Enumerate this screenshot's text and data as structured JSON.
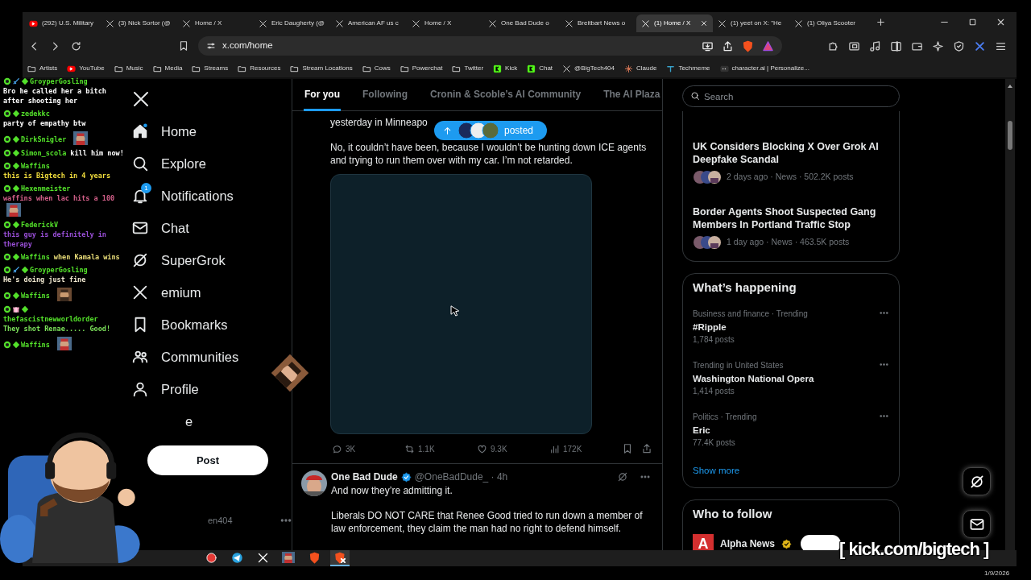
{
  "browser": {
    "tabs": [
      {
        "title": "(292) U.S. Military",
        "kind": "youtube",
        "selected": false
      },
      {
        "title": "(3) Nick Sortor (@",
        "kind": "x",
        "selected": false
      },
      {
        "title": "Home / X",
        "kind": "x",
        "selected": false
      },
      {
        "title": "Eric Daugherty (@",
        "kind": "x",
        "selected": false
      },
      {
        "title": "American AF us c",
        "kind": "x",
        "selected": false
      },
      {
        "title": "Home / X",
        "kind": "x",
        "selected": false
      },
      {
        "title": "One Bad Dude o",
        "kind": "x",
        "selected": false
      },
      {
        "title": "Breitbart News o",
        "kind": "x",
        "selected": false
      },
      {
        "title": "(1) Home / X",
        "kind": "x",
        "selected": true
      },
      {
        "title": "(1) yeet on X: \"He",
        "kind": "x",
        "selected": false
      },
      {
        "title": "(1) Oliya Scooter",
        "kind": "x",
        "selected": false
      }
    ],
    "address": "x.com/home",
    "bookmarks": [
      {
        "label": "Artists",
        "kind": "folder"
      },
      {
        "label": "YouTube",
        "kind": "youtube"
      },
      {
        "label": "Music",
        "kind": "folder"
      },
      {
        "label": "Media",
        "kind": "folder"
      },
      {
        "label": "Streams",
        "kind": "folder"
      },
      {
        "label": "Resources",
        "kind": "folder"
      },
      {
        "label": "Stream Locations",
        "kind": "folder"
      },
      {
        "label": "Cows",
        "kind": "folder"
      },
      {
        "label": "Powerchat",
        "kind": "folder"
      },
      {
        "label": "Twitter",
        "kind": "folder"
      },
      {
        "label": "Kick",
        "kind": "kick"
      },
      {
        "label": "Chat",
        "kind": "kick"
      },
      {
        "label": "@BigTech404",
        "kind": "x"
      },
      {
        "label": "Claude",
        "kind": "claude"
      },
      {
        "label": "Techmeme",
        "kind": "techmeme"
      },
      {
        "label": "character.ai | Personalize...",
        "kind": "charai"
      }
    ]
  },
  "x": {
    "nav": [
      {
        "label": "Home",
        "kind": "home"
      },
      {
        "label": "Explore",
        "kind": "search"
      },
      {
        "label": "Notifications",
        "kind": "bell",
        "badge": "1"
      },
      {
        "label": "Chat",
        "kind": "mail"
      },
      {
        "label": "SuperGrok",
        "kind": "grok"
      },
      {
        "label": "emium",
        "kind": "x"
      },
      {
        "label": "Bookmarks",
        "kind": "bookmark"
      },
      {
        "label": "Communities",
        "kind": "people"
      },
      {
        "label": "Profile",
        "kind": "person"
      },
      {
        "label": "e",
        "kind": "plain"
      }
    ],
    "post_button": "Post",
    "account_handle": "en404",
    "feed_tabs": [
      {
        "label": "For you",
        "selected": true
      },
      {
        "label": "Following",
        "selected": false
      },
      {
        "label": "Cronin & Scoble’s AI Community",
        "selected": false
      },
      {
        "label": "The AI Plaza",
        "selected": false
      }
    ],
    "new_posts_pill": "posted",
    "posts": [
      {
        "paragraphs": [
          "yesterday in Minneapo",
          "No, it couldn’t have been, because I wouldn’t be hunting down ICE agents and trying to run them over with my car. I’m not retarded."
        ],
        "media": true,
        "stats": [
          {
            "kind": "replies",
            "value": "3K"
          },
          {
            "kind": "reposts",
            "value": "1.1K"
          },
          {
            "kind": "likes",
            "value": "9.3K"
          },
          {
            "kind": "views",
            "value": "172K"
          }
        ]
      },
      {
        "author": "One Bad Dude",
        "verified": true,
        "handle": "@OneBadDude_ · 4h",
        "paragraphs": [
          "And now they’re admitting it.",
          "Liberals DO NOT CARE that Renee Good tried to run down a member of law enforcement, they claim the man had no right to defend himself."
        ]
      }
    ],
    "search": {
      "placeholder": "Search"
    },
    "news": [
      {
        "title": "UK Considers Blocking X Over Grok AI Deepfake Scandal",
        "meta": "2 days ago · News · 502.2K posts"
      },
      {
        "title": "Border Agents Shoot Suspected Gang Members In Portland Traffic Stop",
        "meta": "1 day ago · News · 463.5K posts"
      }
    ],
    "whats_happening": {
      "title": "What’s happening",
      "trends": [
        {
          "context": "Business and finance · Trending",
          "name": "#Ripple",
          "posts": "1,784 posts"
        },
        {
          "context": "Trending in United States",
          "name": "Washington National Opera",
          "posts": "1,414 posts"
        },
        {
          "context": "Politics · Trending",
          "name": "Eric",
          "posts": "77.4K posts"
        }
      ],
      "show_more": "Show more"
    },
    "who_to_follow": {
      "title": "Who to follow",
      "accounts": [
        {
          "logo": "A",
          "name": "Alpha News",
          "verified": true
        }
      ]
    }
  },
  "chat": [
    {
      "user": "GroyperGosling",
      "badges": [
        {
          "kind": "kick"
        },
        {
          "kind": "sword"
        },
        {
          "kind": "diamond"
        }
      ],
      "text": "Bro he called her a bitch after shooting her",
      "color": "#ffffff"
    },
    {
      "user": "zedekkc",
      "badges": [
        {
          "kind": "kick"
        },
        {
          "kind": "diamond"
        }
      ],
      "text": "party of empathy btw",
      "color": "#ffffff"
    },
    {
      "user": "DirkSnigler",
      "badges": [
        {
          "kind": "kick"
        },
        {
          "kind": "diamond"
        }
      ],
      "emote": true
    },
    {
      "user": "Simon_scola",
      "badges": [
        {
          "kind": "kick"
        },
        {
          "kind": "diamond"
        }
      ],
      "text": "kill him now!",
      "color": "#ffffff"
    },
    {
      "user": "Waffins",
      "badges": [
        {
          "kind": "kick"
        },
        {
          "kind": "diamond"
        }
      ],
      "text": "this is Bigtech in 4 years",
      "color": "#f0dc3c"
    },
    {
      "user": "Hexenmeister",
      "badges": [
        {
          "kind": "kick"
        },
        {
          "kind": "diamond"
        }
      ],
      "text": "waffins when lac hits a 100",
      "color": "#d4608a",
      "emote": true
    },
    {
      "user": "FederickV",
      "badges": [
        {
          "kind": "kick"
        },
        {
          "kind": "diamond"
        }
      ],
      "text": "this guy is definitely in therapy",
      "color": "#9a4fd8"
    },
    {
      "user": "Waffins",
      "badges": [
        {
          "kind": "kick"
        },
        {
          "kind": "diamond"
        }
      ],
      "text": "when Kamala wins",
      "color": "#e8dc78"
    },
    {
      "user": "GroyperGosling",
      "badges": [
        {
          "kind": "kick"
        },
        {
          "kind": "sword"
        },
        {
          "kind": "diamond"
        }
      ],
      "text": "He's doing just fine",
      "color": "#f0e8d0"
    },
    {
      "user": "Waffins",
      "badges": [
        {
          "kind": "kick"
        },
        {
          "kind": "diamond"
        }
      ],
      "emote": true
    },
    {
      "user": "thefascistnewworldorder",
      "badges": [
        {
          "kind": "kick"
        },
        {
          "kind": "gift"
        },
        {
          "kind": "diamond"
        }
      ],
      "text": "They shot Renae..... Good!",
      "color": "#7be05a"
    },
    {
      "user": "Waffins",
      "badges": [
        {
          "kind": "kick"
        },
        {
          "kind": "diamond"
        }
      ],
      "emote": true
    }
  ],
  "taskbar": [
    {
      "kind": "app",
      "selected": false
    },
    {
      "kind": "telegram",
      "selected": false
    },
    {
      "kind": "x",
      "selected": false
    },
    {
      "kind": "thumbnail",
      "selected": false
    },
    {
      "kind": "brave",
      "selected": false
    },
    {
      "kind": "brave-x",
      "selected": true
    }
  ],
  "stream": {
    "link": "[ kick.com/bigtech ]",
    "date": "1/9/2026"
  }
}
